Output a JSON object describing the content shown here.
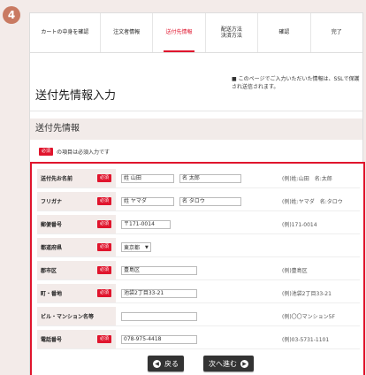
{
  "step_number": "4",
  "steps": [
    {
      "label": "カートの中身を確認"
    },
    {
      "label": "注文者情報"
    },
    {
      "label": "送付先情報"
    },
    {
      "label": "配送方法\n決済方法"
    },
    {
      "label": "確認"
    },
    {
      "label": "完了"
    }
  ],
  "page_title": "送付先情報入力",
  "note_bullet": "■",
  "note": "このページでご入力いただいた情報は、SSLで保護され送信されます。",
  "section_title": "送付先情報",
  "required_badge": "必須",
  "required_note": "の項目は必須入力です",
  "fields": [
    {
      "label": "送付先お名前",
      "values": [
        "姓 山田",
        "名 太郎"
      ],
      "example": "(例)姓:山田　名:太郎"
    },
    {
      "label": "フリガナ",
      "values": [
        "姓 ヤマダ",
        "名 タロウ"
      ],
      "example": "(例)姓:ヤマダ　名:タロウ"
    },
    {
      "label": "郵便番号",
      "values": [
        "〒171-0014"
      ],
      "example": "(例)171-0014"
    },
    {
      "label": "都道府県",
      "values": [
        "東京都"
      ],
      "example": ""
    },
    {
      "label": "郡市区",
      "values": [
        "豊島区"
      ],
      "example": "(例)豊島区"
    },
    {
      "label": "町・番地",
      "values": [
        "池袋2丁目33-21"
      ],
      "example": "(例)池袋2丁目33-21"
    },
    {
      "label": "ビル・マンション名等",
      "values": [
        ""
      ],
      "example": "(例)〇〇マンション5F"
    },
    {
      "label": "電話番号",
      "values": [
        "078-975-4418"
      ],
      "example": "(例)03-5731-1101"
    }
  ],
  "buttons": {
    "back": "戻る",
    "next": "次へ進む"
  }
}
